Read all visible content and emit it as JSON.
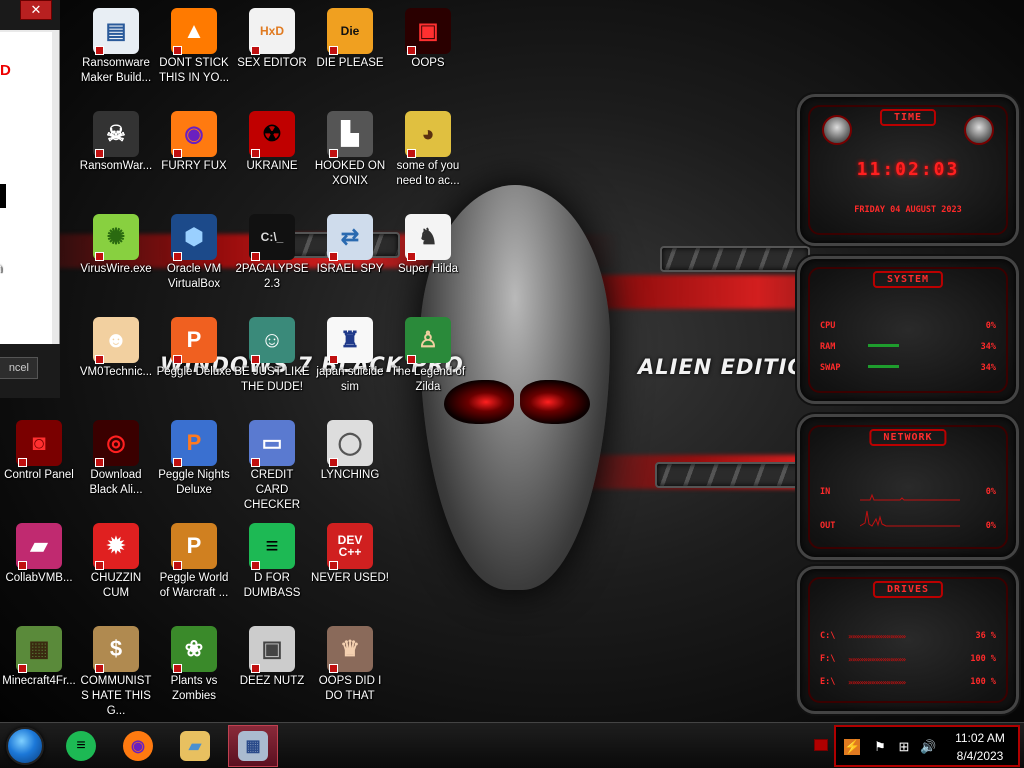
{
  "wallpaper": {
    "left_text": "WINDOWS 7 BLACK PRO",
    "right_text": "ALIEN EDITION 20"
  },
  "background_window": {
    "close_label": "✕",
    "red_fragment": "D",
    "cancel_label": "ncel"
  },
  "icons": [
    {
      "label": "Ransomware Maker Build...",
      "glyph": "▤",
      "bg": "#e8eef4",
      "fg": "#2a5a9a"
    },
    {
      "label": "DONT STICK THIS IN YO...",
      "glyph": "▲",
      "bg": "#ff7a00",
      "fg": "#ffffff"
    },
    {
      "label": "SEX EDITOR",
      "glyph": "HxD",
      "bg": "#f2f2f2",
      "fg": "#e07a20"
    },
    {
      "label": "DIE PLEASE",
      "glyph": "Die",
      "bg": "#f0a020",
      "fg": "#111111"
    },
    {
      "label": "OOPS",
      "glyph": "▣",
      "bg": "#2a0000",
      "fg": "#ff3030"
    },
    {
      "label": "RansomWar...",
      "glyph": "☠",
      "bg": "#333333",
      "fg": "#ffffff"
    },
    {
      "label": "FURRY FUX",
      "glyph": "◉",
      "bg": "#ff7a10",
      "fg": "#6a20c0"
    },
    {
      "label": "UKRAINE",
      "glyph": "☢",
      "bg": "#c00000",
      "fg": "#000000"
    },
    {
      "label": "HOOKED ON XONIX",
      "glyph": "▙",
      "bg": "#555555",
      "fg": "#ffffff"
    },
    {
      "label": "some of you need to ac...",
      "glyph": "◕",
      "bg": "#e0c040",
      "fg": "#5a3010"
    },
    {
      "label": "n",
      "glyph": "",
      "bg": "transparent",
      "fg": "#ffffff"
    },
    {
      "label": "VirusWire.exe",
      "glyph": "✺",
      "bg": "#88d040",
      "fg": "#2a6a10"
    },
    {
      "label": "Oracle VM VirtualBox",
      "glyph": "⬢",
      "bg": "#1c4a8a",
      "fg": "#9ad0ff"
    },
    {
      "label": "2PACALYPSE 2.3",
      "glyph": "C:\\_",
      "bg": "#111111",
      "fg": "#dddddd"
    },
    {
      "label": "ISRAEL SPY",
      "glyph": "⇄",
      "bg": "#cfdcec",
      "fg": "#2a6ab0"
    },
    {
      "label": "Super Hilda",
      "glyph": "♞",
      "bg": "#f4f4f4",
      "fg": "#333333"
    },
    {
      "label": "VM0Technic...",
      "glyph": "☻",
      "bg": "#f2d0a0",
      "fg": "#ffffff"
    },
    {
      "label": "Peggle Deluxe",
      "glyph": "P",
      "bg": "#f06020",
      "fg": "#ffffff"
    },
    {
      "label": "BE JUST LIKE THE DUDE!",
      "glyph": "☺",
      "bg": "#3a8a7a",
      "fg": "#ffffff"
    },
    {
      "label": "japan suicide sim",
      "glyph": "♜",
      "bg": "#f8f8f8",
      "fg": "#203a8a"
    },
    {
      "label": "The Legend of Zilda",
      "glyph": "♙",
      "bg": "#2a8a3a",
      "fg": "#f0d0a0"
    },
    {
      "label": "Control Panel",
      "glyph": "◙",
      "bg": "#7a0000",
      "fg": "#ff3030"
    },
    {
      "label": "Download Black Ali...",
      "glyph": "◎",
      "bg": "#3a0000",
      "fg": "#ff2020"
    },
    {
      "label": "Peggle Nights Deluxe",
      "glyph": "P",
      "bg": "#3a70d0",
      "fg": "#ff7a20"
    },
    {
      "label": "CREDIT CARD CHECKER",
      "glyph": "▭",
      "bg": "#5a7ad0",
      "fg": "#ffffff"
    },
    {
      "label": "LYNCHING",
      "glyph": "◯",
      "bg": "#dddddd",
      "fg": "#555555"
    },
    {
      "label": "CollabVMB...",
      "glyph": "▰",
      "bg": "#c02a70",
      "fg": "#ffffff"
    },
    {
      "label": "CHUZZIN CUM",
      "glyph": "✹",
      "bg": "#e02020",
      "fg": "#ffffff"
    },
    {
      "label": "Peggle World of Warcraft ...",
      "glyph": "P",
      "bg": "#d08020",
      "fg": "#ffffff"
    },
    {
      "label": "D FOR DUMBASS",
      "glyph": "≡",
      "bg": "#1db954",
      "fg": "#000000"
    },
    {
      "label": "NEVER USED!",
      "glyph": "DEV C++",
      "bg": "#d02020",
      "fg": "#ffffff"
    },
    {
      "label": "Minecraft4Fr...",
      "glyph": "▦",
      "bg": "#5a8a3a",
      "fg": "#3a2a10"
    },
    {
      "label": "COMMUNISTS HATE THIS G...",
      "glyph": "$",
      "bg": "#b08a50",
      "fg": "#ffffff"
    },
    {
      "label": "Plants vs Zombies",
      "glyph": "❀",
      "bg": "#3a8a2a",
      "fg": "#ffffff"
    },
    {
      "label": "DEEZ NUTZ",
      "glyph": "▣",
      "bg": "#cccccc",
      "fg": "#444444"
    },
    {
      "label": "OOPS DID I DO THAT",
      "glyph": "♛",
      "bg": "#8a6a5a",
      "fg": "#f4d0b0"
    }
  ],
  "gadgets": {
    "clock": {
      "header": "TIME",
      "time": "11:02:03",
      "date": "FRIDAY 04 AUGUST 2023"
    },
    "system": {
      "header": "SYSTEM",
      "rows": [
        {
          "label": "CPU",
          "value": "0%",
          "fill": 0.0
        },
        {
          "label": "RAM",
          "value": "34%",
          "fill": 0.34
        },
        {
          "label": "SWAP",
          "value": "34%",
          "fill": 0.34
        }
      ]
    },
    "network": {
      "header": "NETWORK",
      "rows": [
        {
          "label": "IN",
          "value": "0%"
        },
        {
          "label": "OUT",
          "value": "0%"
        }
      ]
    },
    "drives": {
      "header": "DRIVES",
      "rows": [
        {
          "label": "C:\\",
          "value": "36 %"
        },
        {
          "label": "F:\\",
          "value": "100 %"
        },
        {
          "label": "E:\\",
          "value": "100 %"
        }
      ]
    }
  },
  "taskbar": {
    "pinned": [
      {
        "name": "spotify",
        "glyph": "≡",
        "bg": "#1db954",
        "fg": "#000000"
      },
      {
        "name": "firefox",
        "glyph": "◉",
        "bg": "#ff7a10",
        "fg": "#6a20c0"
      },
      {
        "name": "explorer",
        "glyph": "▰",
        "bg": "#e8c060",
        "fg": "#4a90d0"
      },
      {
        "name": "remote",
        "glyph": "▦",
        "bg": "#aabbd0",
        "fg": "#2a4a8a"
      }
    ],
    "clock": {
      "time": "11:02 AM",
      "date": "8/4/2023"
    }
  }
}
